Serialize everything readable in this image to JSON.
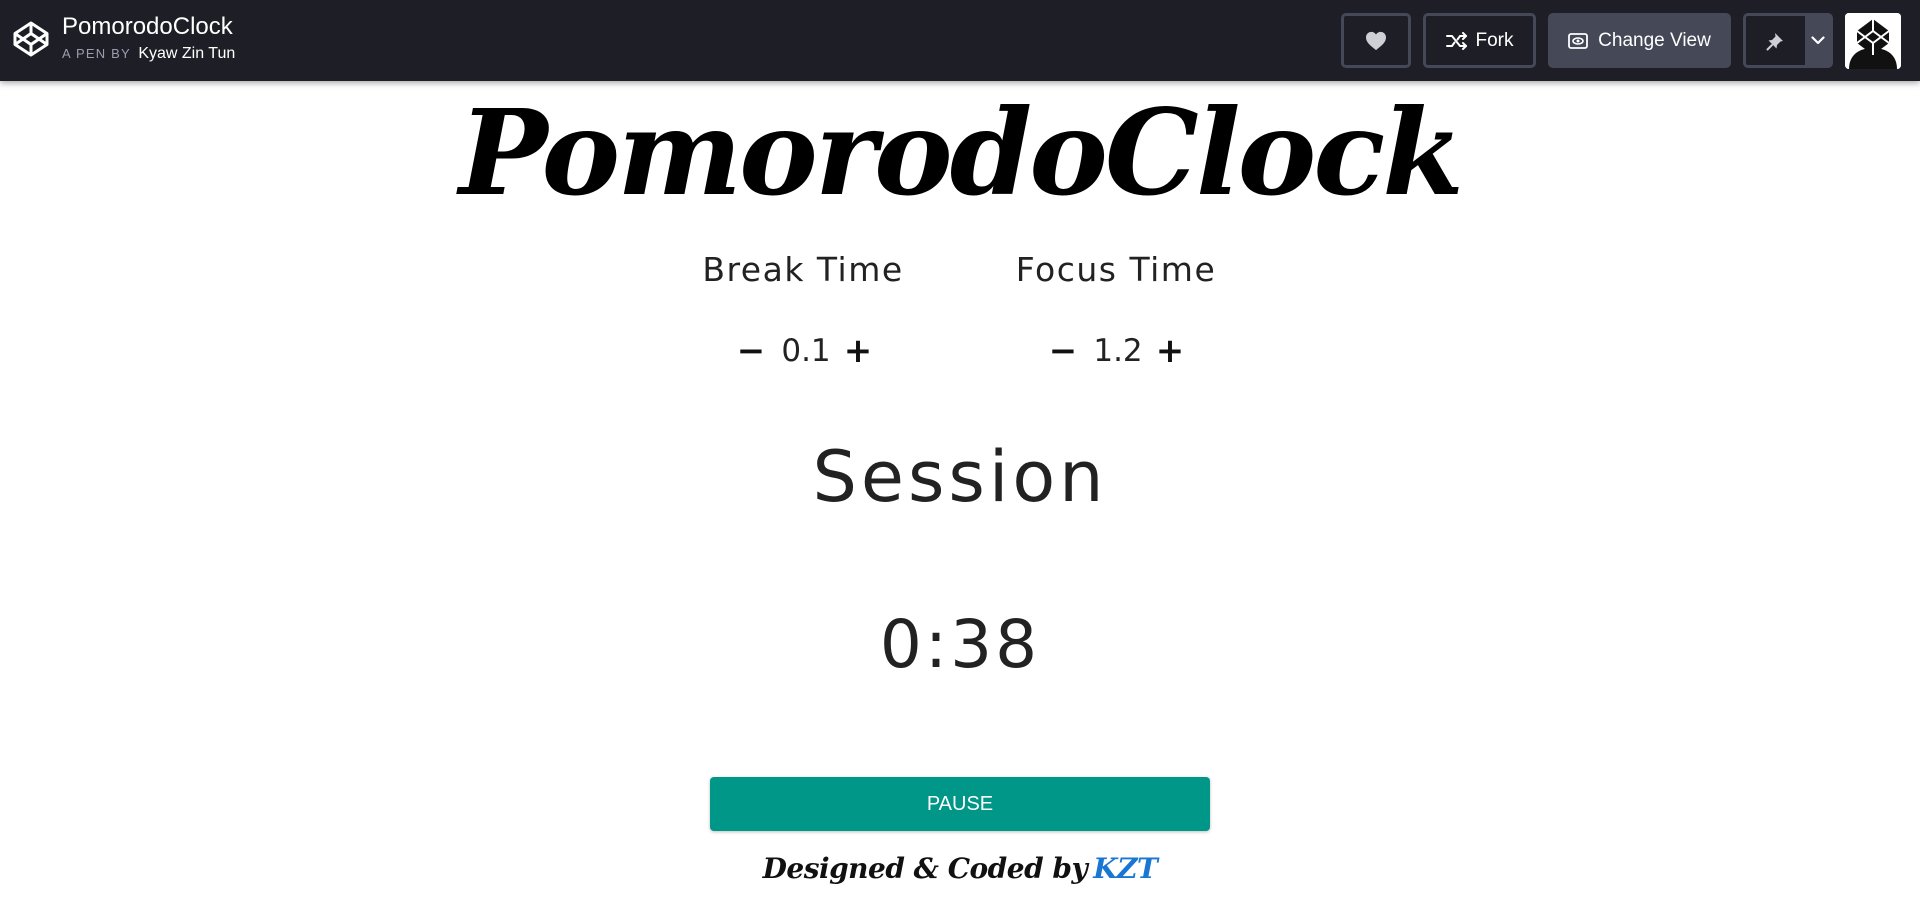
{
  "header": {
    "pen_title": "PomorodoClock",
    "byline_prefix": "A PEN BY",
    "author": "Kyaw Zin Tun",
    "fork_label": "Fork",
    "change_view_label": "Change View",
    "icons": [
      "codepen-logo-icon",
      "heart-icon",
      "fork-icon",
      "eye-icon",
      "pin-icon",
      "chevron-down-icon",
      "avatar"
    ]
  },
  "app": {
    "title": "PomorodoClock",
    "break": {
      "label": "Break Time",
      "minus": "−",
      "value": "0.1",
      "plus": "+"
    },
    "focus": {
      "label": "Focus Time",
      "minus": "−",
      "value": "1.2",
      "plus": "+"
    },
    "session_label": "Session",
    "timer": "0:38",
    "pause_label": "PAUSE",
    "footer_text": "Designed & Coded by",
    "footer_link": "KZT"
  },
  "colors": {
    "header_bg": "#1e1f26",
    "header_button_border": "#444857",
    "pause_button": "#009688",
    "footer_link": "#1976d2"
  }
}
